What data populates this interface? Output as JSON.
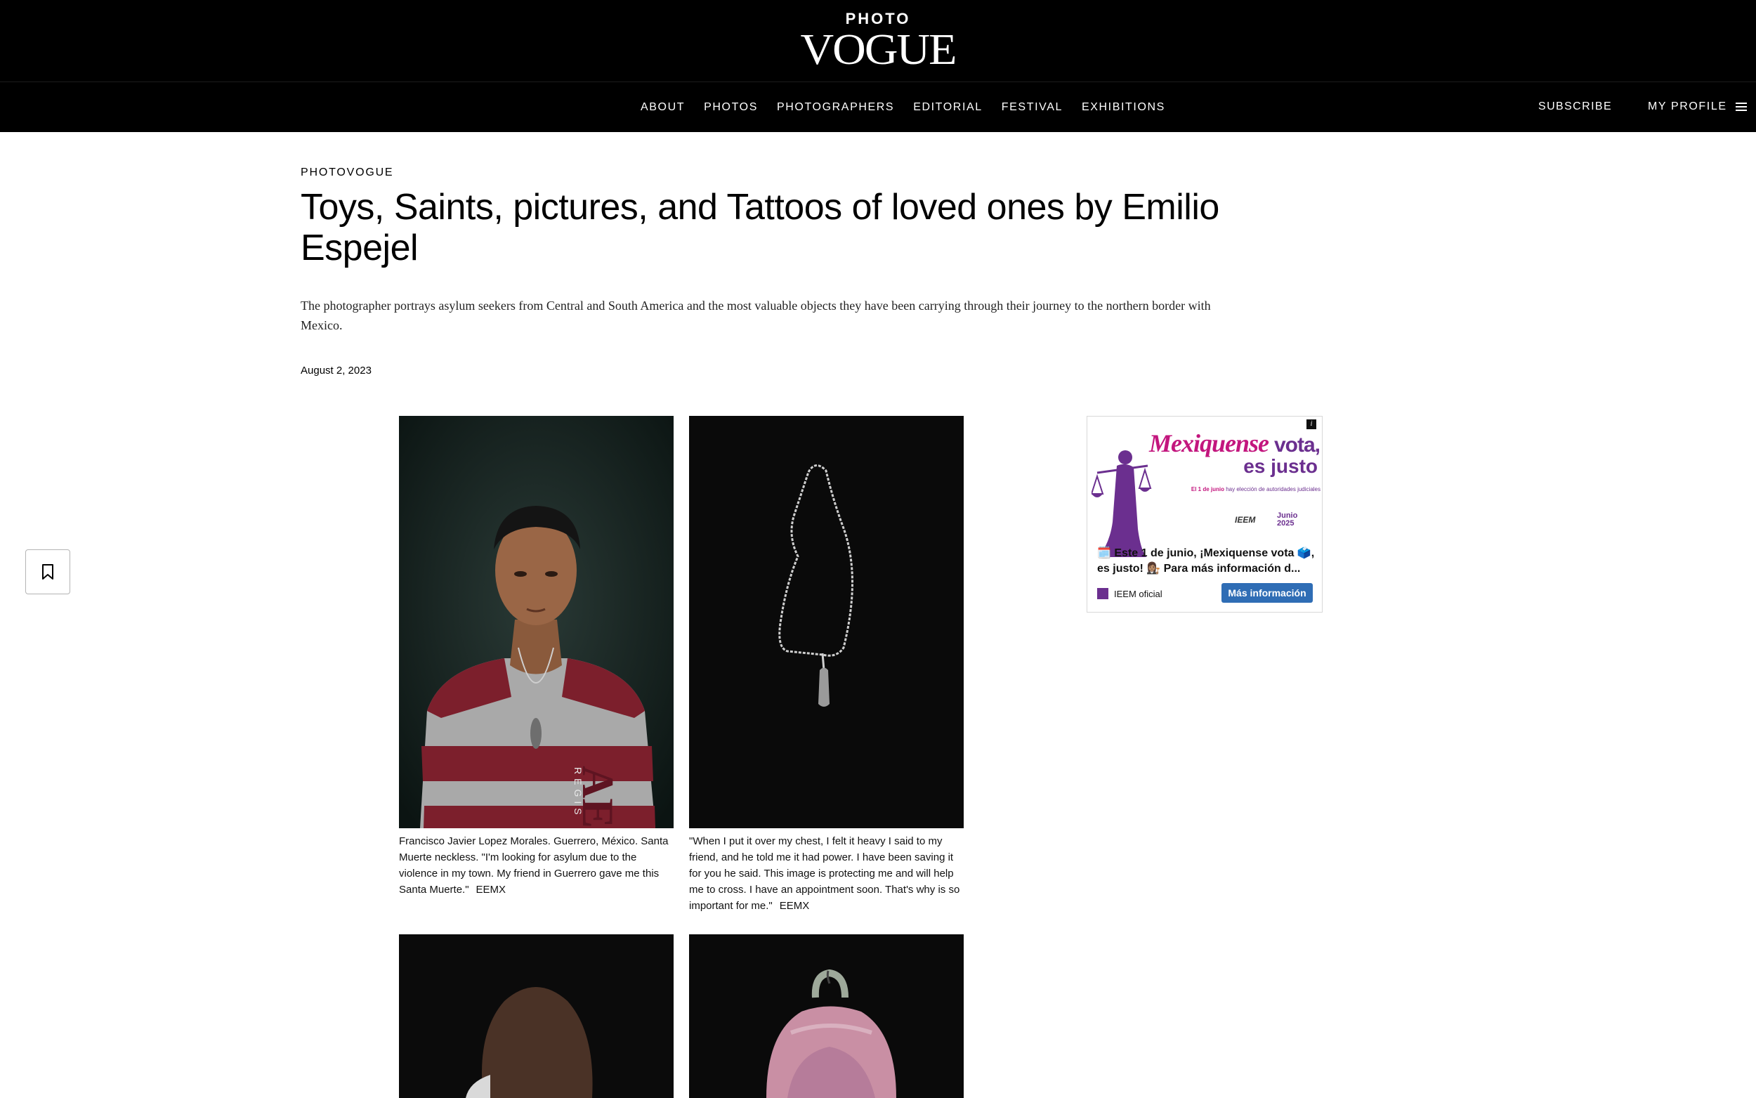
{
  "header": {
    "logo_top": "PHOTO",
    "logo_main": "VOGUE",
    "nav": [
      "ABOUT",
      "PHOTOS",
      "PHOTOGRAPHERS",
      "EDITORIAL",
      "FESTIVAL",
      "EXHIBITIONS"
    ],
    "subscribe": "SUBSCRIBE",
    "profile": "MY PROFILE"
  },
  "article": {
    "rubric": "PHOTOVOGUE",
    "title": "Toys, Saints, pictures, and Tattoos of loved ones by Emilio Espejel",
    "dek": "The photographer portrays asylum seekers from Central and South America and the most valuable objects they have been carrying through their journey to the northern border with Mexico.",
    "date": "August 2, 2023"
  },
  "photos": [
    {
      "caption": "Francisco Javier Lopez Morales. Guerrero, México. Santa Muerte neckless. \"I'm looking for asylum due to the violence in my town. My friend in Guerrero gave me this Santa Muerte.\"",
      "credit": "EEMX",
      "shirt_text": "AE",
      "shirt_subtext": "REGIS"
    },
    {
      "caption": "\"When I put it over my chest, I felt it heavy I said to my friend, and he told me it had power. I have been saving it for you he said. This image is protecting me and will help me to cross. I have an appointment soon. That's why is so important for me.\"",
      "credit": "EEMX"
    },
    {
      "caption": "",
      "credit": ""
    },
    {
      "caption": "",
      "credit": ""
    }
  ],
  "ad": {
    "badge": "i",
    "headline_script": "Mexiquense",
    "headline_bold": "vota,",
    "headline_line2": "es justo",
    "sub_pre": "El 1 de junio",
    "sub_post": "hay elección de autoridades judiciales",
    "logo_ieem": "IEEM",
    "logo_junio": "Junio",
    "logo_year": "2025",
    "text_line1": "🗓️ Este 1 de junio, ¡Mexiquense vota 🗳️,",
    "text_line2": "es justo! 👩🏽‍⚖️ Para más información d...",
    "brand": "IEEM oficial",
    "cta": "Más información"
  },
  "colors": {
    "header_bg": "#000000",
    "ad_magenta": "#c3167e",
    "ad_purple": "#6b2f8f",
    "ad_button": "#2f6db5"
  }
}
